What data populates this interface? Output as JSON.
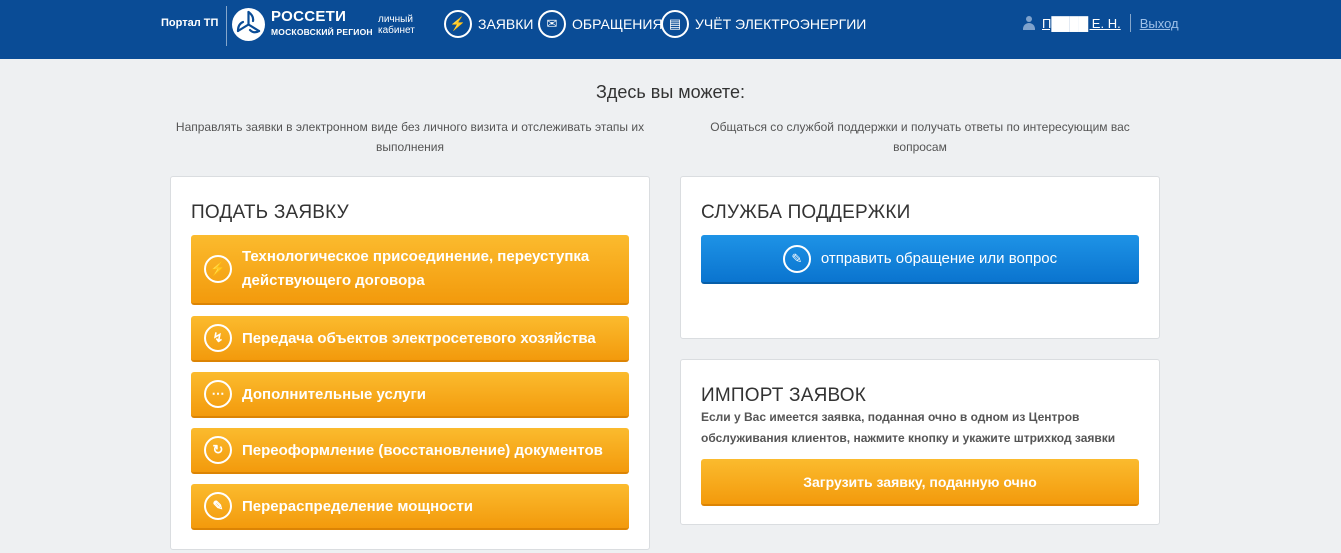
{
  "header": {
    "portal": "Портал ТП",
    "brand_name": "РОССЕТИ",
    "brand_region": "МОСКОВСКИЙ РЕГИОН",
    "cabinet": "личный кабинет",
    "nav": [
      {
        "label": "ЗАЯВКИ",
        "icon": "lightning-icon"
      },
      {
        "label": "ОБРАЩЕНИЯ",
        "icon": "envelope-icon"
      },
      {
        "label": "УЧЁТ ЭЛЕКТРОЭНЕРГИИ",
        "icon": "meter-icon"
      }
    ],
    "user_name": "П████ Е. Н.",
    "logout": "Выход"
  },
  "intro": {
    "headline": "Здесь вы можете:",
    "left_text": "Направлять заявки в электронном виде без личного визита и отслеживать этапы их выполнения",
    "right_text": "Общаться со службой поддержки и получать ответы по интересующим вас вопросам"
  },
  "submit": {
    "title": "ПОДАТЬ ЗАЯВКУ",
    "buttons": [
      {
        "label": "Технологическое присоединение, переуступка действующего договора",
        "icon": "lightning-icon"
      },
      {
        "label": "Передача объектов электросетевого хозяйства",
        "icon": "transfer-icon"
      },
      {
        "label": "Дополнительные услуги",
        "icon": "dots-icon"
      },
      {
        "label": "Переоформление (восстановление) документов",
        "icon": "refresh-icon"
      },
      {
        "label": "Перераспределение мощности",
        "icon": "redistribute-icon"
      }
    ]
  },
  "support": {
    "title": "СЛУЖБА ПОДДЕРЖКИ",
    "button": "отправить обращение или вопрос",
    "icon": "pencil-icon"
  },
  "import": {
    "title": "ИМПОРТ ЗАЯВОК",
    "description": "Если у Вас имеется заявка, поданная очно в одном из Центров обслуживания клиентов, нажмите кнопку и укажите штрихкод заявки",
    "button": "Загрузить заявку, поданную очно"
  },
  "colors": {
    "header_bg": "#0a4c96",
    "orange": "#f5a316",
    "blue": "#0f82dc",
    "page_bg": "#eef0f2"
  }
}
